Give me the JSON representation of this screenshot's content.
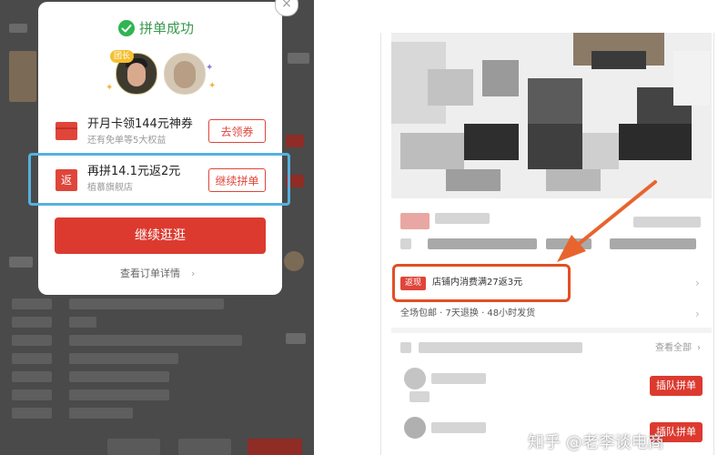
{
  "left_phone": {
    "popup": {
      "close_icon": "×",
      "title": "拼单成功",
      "leader_badge": "团长",
      "offers": [
        {
          "title": "开月卡领144元神券",
          "subtitle": "还有免单等5大权益",
          "button": "去领券",
          "icon": "card-icon"
        },
        {
          "title": "再拼14.1元返2元",
          "subtitle": "植慕旗舰店",
          "button": "继续拼单",
          "icon_text": "返"
        }
      ],
      "primary_button": "继续逛逛",
      "view_order": "查看订单详情",
      "view_order_chevron": "›"
    }
  },
  "right_phone": {
    "promo": {
      "tag": "返现",
      "text": "店铺内消费满27返3元",
      "chevron": "›"
    },
    "services": "全场包邮 · 7天退换 · 48小时发货",
    "services_chevron": "›",
    "group_list": {
      "view_all": "查看全部",
      "view_all_chevron": "›",
      "join_button_1": "插队拼单",
      "join_button_2": "插队拼单"
    }
  },
  "watermark": "知乎 @老李谈电商",
  "colors": {
    "accent_red": "#dc3a2f",
    "highlight_blue": "#55b1de",
    "annotation_orange": "#e24f25",
    "success_green": "#2fb551"
  }
}
